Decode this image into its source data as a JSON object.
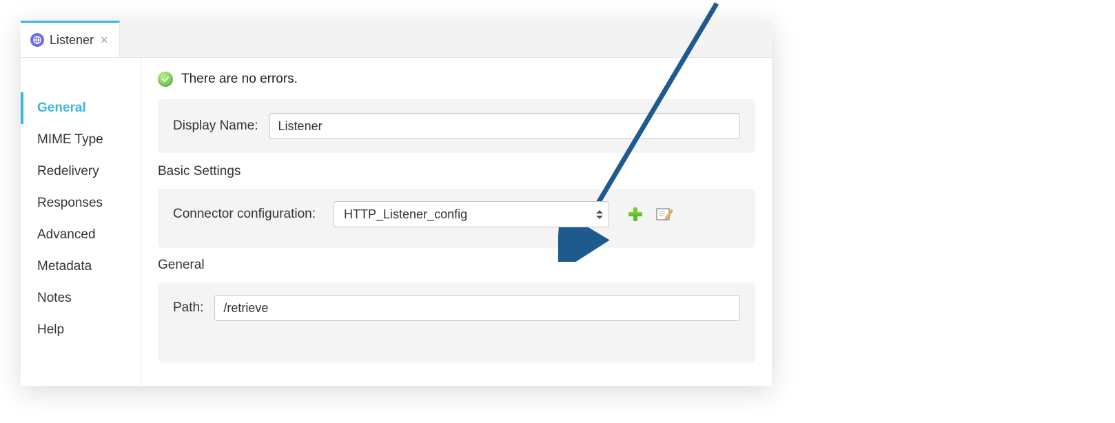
{
  "tab": {
    "title": "Listener"
  },
  "sidebar": {
    "items": [
      {
        "label": "General",
        "active": true
      },
      {
        "label": "MIME Type",
        "active": false
      },
      {
        "label": "Redelivery",
        "active": false
      },
      {
        "label": "Responses",
        "active": false
      },
      {
        "label": "Advanced",
        "active": false
      },
      {
        "label": "Metadata",
        "active": false
      },
      {
        "label": "Notes",
        "active": false
      },
      {
        "label": "Help",
        "active": false
      }
    ]
  },
  "status": {
    "message": "There are no errors."
  },
  "display_name": {
    "label": "Display Name:",
    "value": "Listener"
  },
  "basic_settings": {
    "title": "Basic Settings",
    "connector_label": "Connector configuration:",
    "connector_value": "HTTP_Listener_config"
  },
  "general": {
    "title": "General",
    "path_label": "Path:",
    "path_value": "/retrieve"
  }
}
